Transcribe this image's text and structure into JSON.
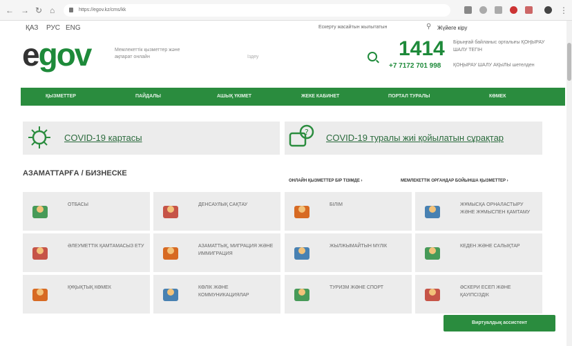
{
  "browser": {
    "url": "https://egov.kz/cms/kk"
  },
  "topbar": {
    "languages": [
      "ҚАЗ",
      "РУС",
      "ENG"
    ],
    "link": "Ескерту жасайтын жылытатын",
    "login": "Жүйеге кіру"
  },
  "header": {
    "logo_e": "e",
    "logo_gov": "gov",
    "tagline": "Мемлекеттік қызметтер және ақпарат онлайн",
    "search_placeholder": "Іздеу",
    "call_number": "1414",
    "call_text": "Бірыңғай байланыс орталығы ҚОҢЫРАУ ШАЛУ ТЕГІН",
    "phone": "+7 7172 701 998",
    "phone_text": "ҚОҢЫРАУ ШАЛУ АҚЫЛЫ шетелден"
  },
  "nav": {
    "items": [
      "ҚЫЗМЕТТЕР",
      "ПАЙДАЛЫ",
      "АШЫҚ ҮКІМЕТ",
      "ЖЕКЕ КАБИНЕТ",
      "ПОРТАЛ ТУРАЛЫ",
      "КӨМЕК"
    ]
  },
  "banners": [
    {
      "text": "COVID-19 картасы"
    },
    {
      "text": "COVID-19 туралы жиі қойылатын сұрақтар"
    }
  ],
  "section": {
    "title": "АЗАМАТТАРҒА / БИЗНЕСКЕ",
    "link1": "ОНЛАЙН ҚЫЗМЕТТЕР БІР ТІЗІМДЕ ›",
    "link2": "МЕМЛЕКЕТТІК ОРГАНДАР БОЙЫНША ҚЫЗМЕТТЕР ›"
  },
  "cards": [
    {
      "label": "ОТБАСЫ",
      "icon": "family-icon"
    },
    {
      "label": "ДЕНСАУЛЫҚ САҚТАУ",
      "icon": "health-icon"
    },
    {
      "label": "БІЛІМ",
      "icon": "education-icon"
    },
    {
      "label": "ЖҰМЫСҚА ОРНАЛАСТЫРУ ЖӘНЕ ЖҰМЫСПЕН ҚАМТАМУ",
      "icon": "employment-icon"
    },
    {
      "label": "ӘЛЕУМЕТТІК ҚАМТАМАСЫЗ ЕТУ",
      "icon": "social-icon"
    },
    {
      "label": "АЗАМАТТЫҚ, МИГРАЦИЯ ЖӘНЕ ИММИГРАЦИЯ",
      "icon": "migration-icon"
    },
    {
      "label": "ЖЫЛЖЫМАЙТЫН МҮЛІК",
      "icon": "realty-icon"
    },
    {
      "label": "КЕДЕН ЖӘНЕ САЛЫҚТАР",
      "icon": "customs-icon"
    },
    {
      "label": "ҚҰҚЫҚТЫҚ КӨМЕК",
      "icon": "law-icon"
    },
    {
      "label": "КӨЛІК ЖӘНЕ КОММУНИКАЦИЯЛАР",
      "icon": "transport-icon"
    },
    {
      "label": "ТУРИЗМ ЖӘНЕ СПОРТ",
      "icon": "tourism-icon"
    },
    {
      "label": "ӘСКЕРИ ЕСЕП ЖӘНЕ ҚАУІПСІЗДІК",
      "icon": "military-icon"
    }
  ],
  "assistant": "Виртуалдық ассистент",
  "colors": {
    "brand_green": "#2a8c3e",
    "card_bg": "#ececec"
  }
}
